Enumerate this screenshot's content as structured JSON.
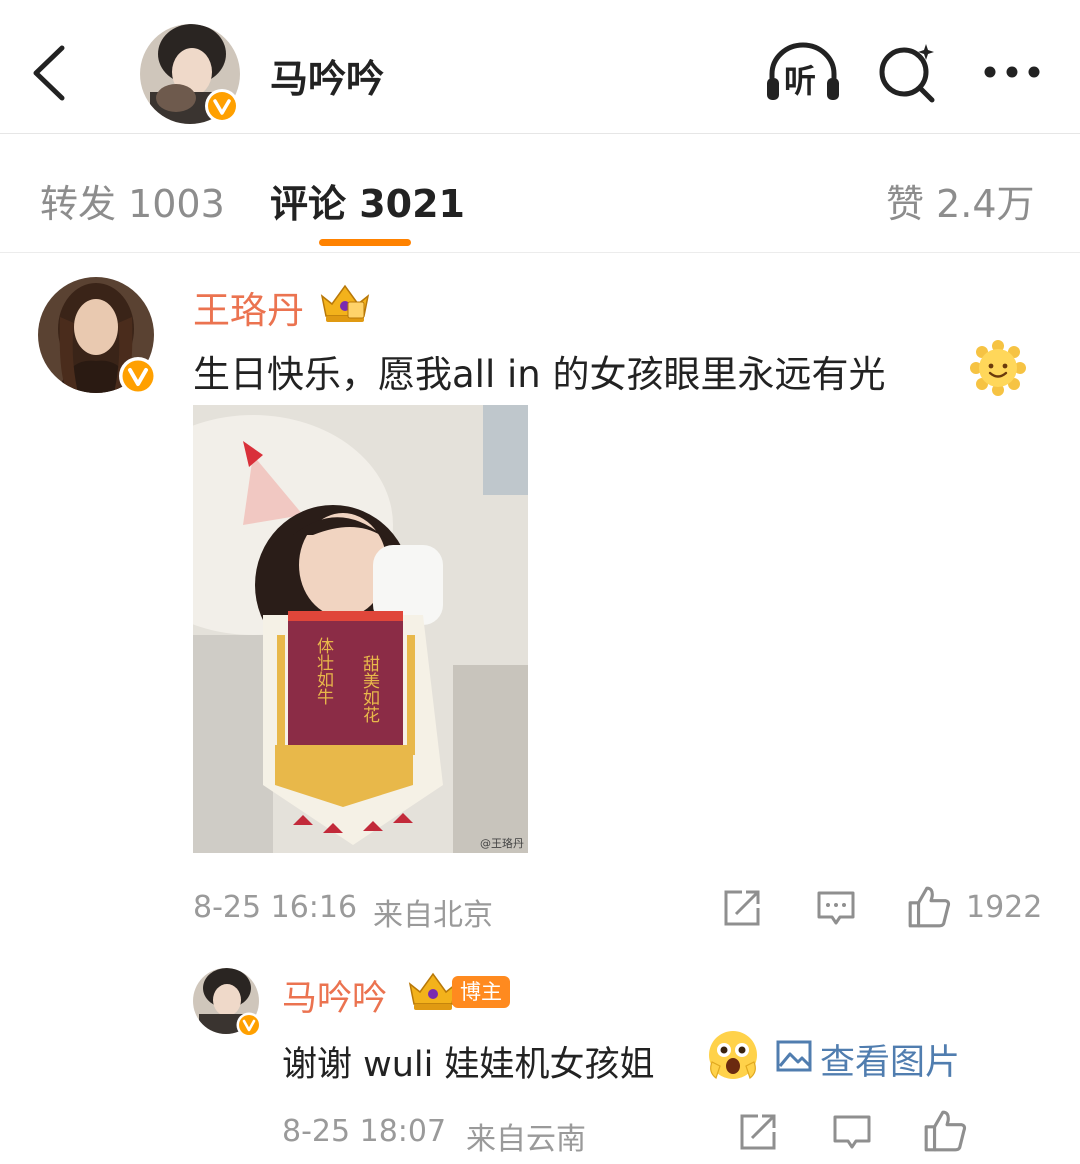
{
  "header": {
    "title": "马吟吟",
    "listen_label": "听"
  },
  "tabs": [
    {
      "label": "转发 1003"
    },
    {
      "label": "评论 3021"
    },
    {
      "label": "赞 2.4万"
    }
  ],
  "comment": {
    "author": "王珞丹",
    "text": "生日快乐，愿我all in 的女孩眼里永远有光",
    "image": {
      "banner_right": "甜美如花",
      "banner_left": "体壮如牛",
      "watermark": "@王珞丹"
    },
    "time": "8-25 16:16",
    "source": "来自北京",
    "likes": "1922"
  },
  "reply": {
    "author": "马吟吟",
    "badge": "博主",
    "text": "谢谢 wuli 娃娃机女孩姐",
    "view_pic": "查看图片",
    "time": "8-25 18:07",
    "source": "来自云南"
  },
  "colors": {
    "accent": "#ff8200",
    "username": "#eb7350",
    "link": "#507daf",
    "verified": "#ffa000"
  },
  "icons": [
    "back-arrow-icon",
    "listen-headphones-icon",
    "search-icon",
    "more-dots-icon",
    "verified-badge-icon",
    "crown-icon",
    "repost-icon",
    "comment-icon",
    "like-icon",
    "image-icon"
  ]
}
